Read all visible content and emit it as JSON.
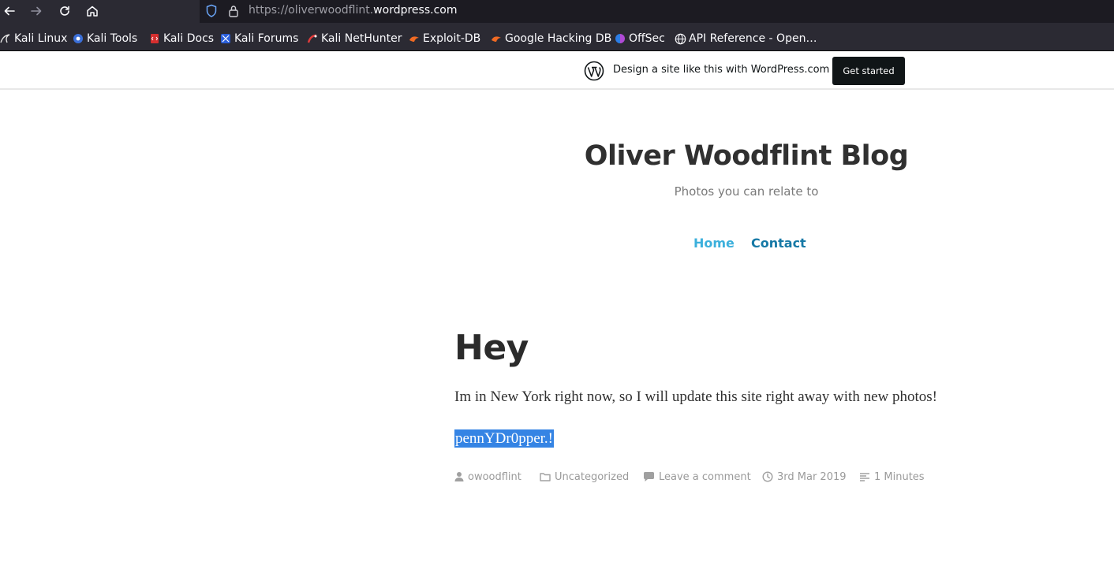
{
  "browser": {
    "url_prefix": "https://oliverwoodflint.",
    "url_domain": "wordpress.com"
  },
  "bookmarks": [
    {
      "label": "Kali Linux",
      "icon": "kali-dragon-icon"
    },
    {
      "label": "Kali Tools",
      "icon": "kali-tools-icon"
    },
    {
      "label": "Kali Docs",
      "icon": "kali-docs-icon"
    },
    {
      "label": "Kali Forums",
      "icon": "kali-forums-icon"
    },
    {
      "label": "Kali NetHunter",
      "icon": "nethunter-icon"
    },
    {
      "label": "Exploit-DB",
      "icon": "exploit-db-icon"
    },
    {
      "label": "Google Hacking DB",
      "icon": "ghdb-icon"
    },
    {
      "label": "OffSec",
      "icon": "offsec-icon"
    },
    {
      "label": "API Reference - Open…",
      "icon": "globe-icon"
    }
  ],
  "wp_banner": {
    "text": "Design a site like this with WordPress.com",
    "button": "Get started"
  },
  "site": {
    "title": "Oliver Woodflint Blog",
    "tagline": "Photos you can relate to",
    "nav": {
      "home": "Home",
      "contact": "Contact"
    }
  },
  "post": {
    "title": "Hey",
    "body": "Im in New York right now, so I will update this site right away with new photos!",
    "selected_text": "pennYDr0pper.!",
    "meta": {
      "author": "owoodflint",
      "category": "Uncategorized",
      "comments": "Leave a comment",
      "date": "3rd Mar 2019",
      "read_time": "1 Minutes"
    }
  },
  "colors": {
    "toolbar_bg": "#2b2a33",
    "urlbar_bg": "#1c1b22",
    "nav_home": "#3cb0dc",
    "nav_contact": "#1679a6",
    "selection": "#3584e4"
  }
}
